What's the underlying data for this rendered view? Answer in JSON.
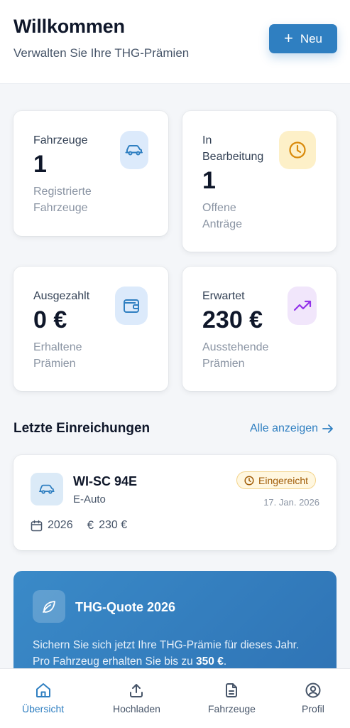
{
  "header": {
    "title": "Willkommen",
    "subtitle": "Verwalten Sie Ihre THG-Prämien",
    "new_button_label": "Neu"
  },
  "stats": [
    {
      "label": "Fahrzeuge",
      "value": "1",
      "desc_line1": "Registrierte",
      "desc_line2": "Fahrzeuge",
      "icon": "car-icon",
      "color": "#2f7fc1"
    },
    {
      "label_line1": "In",
      "label_line2": "Bearbeitung",
      "value": "1",
      "desc_line1": "Offene",
      "desc_line2": "Anträge",
      "icon": "clock-icon",
      "color": "#d98a0b"
    },
    {
      "label": "Ausgezahlt",
      "value": "0 €",
      "desc_line1": "Erhaltene",
      "desc_line2": "Prämien",
      "icon": "wallet-icon",
      "color": "#2f7fc1"
    },
    {
      "label": "Erwartet",
      "value": "230 €",
      "desc_line1": "Ausstehende",
      "desc_line2": "Prämien",
      "icon": "trending-up-icon",
      "color": "#9333ea"
    }
  ],
  "recent": {
    "title": "Letzte Einreichungen",
    "link_label": "Alle anzeigen",
    "items": [
      {
        "plate": "WI-SC 94E",
        "type": "E-Auto",
        "status": "Eingereicht",
        "date": "17. Jan. 2026",
        "year": "2026",
        "amount": "230 €"
      }
    ]
  },
  "promo": {
    "title": "THG-Quote 2026",
    "text_before": "Sichern Sie sich jetzt Ihre THG-Prämie für dieses Jahr. Pro Fahrzeug erhalten Sie bis zu ",
    "text_bold": "350 €",
    "text_after": "."
  },
  "nav": [
    {
      "label": "Übersicht",
      "icon": "home-icon",
      "active": true
    },
    {
      "label": "Hochladen",
      "icon": "upload-icon",
      "active": false
    },
    {
      "label": "Fahrzeuge",
      "icon": "document-icon",
      "active": false
    },
    {
      "label": "Profil",
      "icon": "user-circle-icon",
      "active": false
    }
  ],
  "colors": {
    "accent": "#2f7fc1",
    "status_submitted": "#a15c07",
    "background": "#f4f6f9"
  }
}
